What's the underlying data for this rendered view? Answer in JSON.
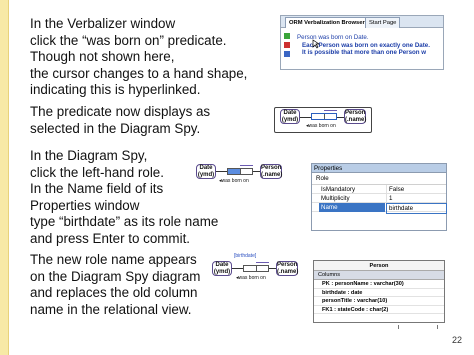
{
  "slide": {
    "block1": "In the Verbalizer window\nclick the “was born on” predicate.\nThough not shown here,\nthe cursor changes to a hand shape,\nindicating this is hyperlinked.",
    "block2": "The predicate now displays as\nselected in the Diagram Spy.",
    "block3": "In the Diagram Spy,\nclick the left-hand role.\nIn the Name field of its\nProperties window\ntype “birthdate” as its role name\nand press Enter to commit.",
    "block4": "The new role name appears\non the Diagram Spy diagram\nand replaces the old column\nname in the relational view.",
    "page_number": "22",
    "colors": {
      "band": "#f7e9a6",
      "selection": "#3a74c4",
      "role_selected": "#5b8de0"
    }
  },
  "verbalizer": {
    "tab_active": "ORM Verbalization Browser",
    "tab_inactive": "Start Page",
    "line1_a": "Person was born on Date.",
    "line2_a": "Each Person was born on ",
    "line2_b": "exactly one",
    "line2_c": " Date.",
    "line3": "It is possible that more than one Person w",
    "icons": [
      "back-icon",
      "forward-icon",
      "home-icon"
    ]
  },
  "orm": {
    "date_entity": "Date\n(ymd)",
    "person_entity": "Person\n(.name)",
    "fact_label": "was born on",
    "fact_label_b": "◂was born on",
    "role_name": "[birthdate]"
  },
  "properties": {
    "title": "Properties",
    "subtitle": "Role",
    "rows": [
      {
        "name": "IsMandatory",
        "value": "False"
      },
      {
        "name": "Multiplicity",
        "value": "1"
      },
      {
        "name": "Name",
        "value": "birthdate"
      }
    ]
  },
  "relational": {
    "table_name": "Person",
    "columns_label": "Columns",
    "rows": [
      "PK : personName : varchar(30)",
      "birthdate : date",
      "personTitle : varchar(10)",
      "FK1 : stateCode : char(2)"
    ]
  }
}
